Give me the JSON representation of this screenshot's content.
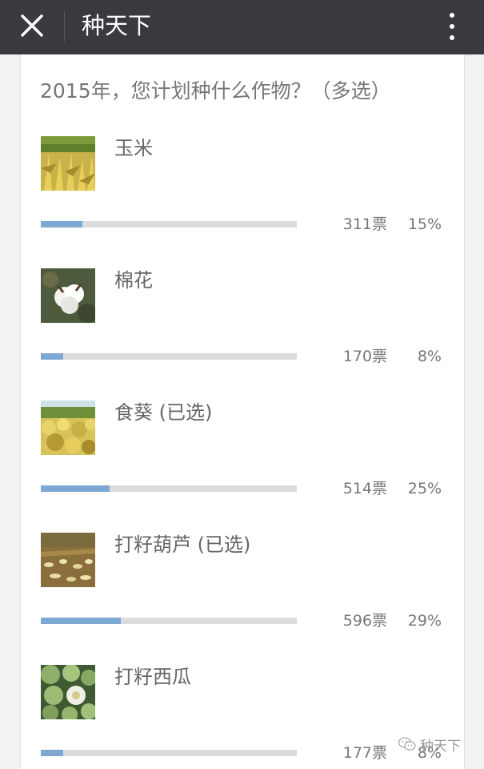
{
  "header": {
    "title": "种天下",
    "close_icon": "close-icon",
    "more_icon": "more-vertical-icon"
  },
  "question": "2015年，您计划种什么作物？（多选）",
  "options": [
    {
      "label": "玉米",
      "votes": "311票",
      "percent": "15%",
      "fraction": 0.15,
      "image": "corn-field"
    },
    {
      "label": "棉花",
      "votes": "170票",
      "percent": "8%",
      "fraction": 0.08,
      "image": "cotton-boll"
    },
    {
      "label": "食葵 (已选)",
      "votes": "514票",
      "percent": "25%",
      "fraction": 0.25,
      "image": "sunflower-field"
    },
    {
      "label": "打籽葫芦 (已选)",
      "votes": "596票",
      "percent": "29%",
      "fraction": 0.29,
      "image": "gourd-field"
    },
    {
      "label": "打籽西瓜",
      "votes": "177票",
      "percent": "8%",
      "fraction": 0.08,
      "image": "melons"
    }
  ],
  "watermark": {
    "text": "种天下",
    "icon": "wechat-icon"
  },
  "colors": {
    "topbar": "#393a3f",
    "bar_fill": "#7ea8d4",
    "bar_track": "#dcdcdc",
    "background": "#f2f2f2"
  }
}
